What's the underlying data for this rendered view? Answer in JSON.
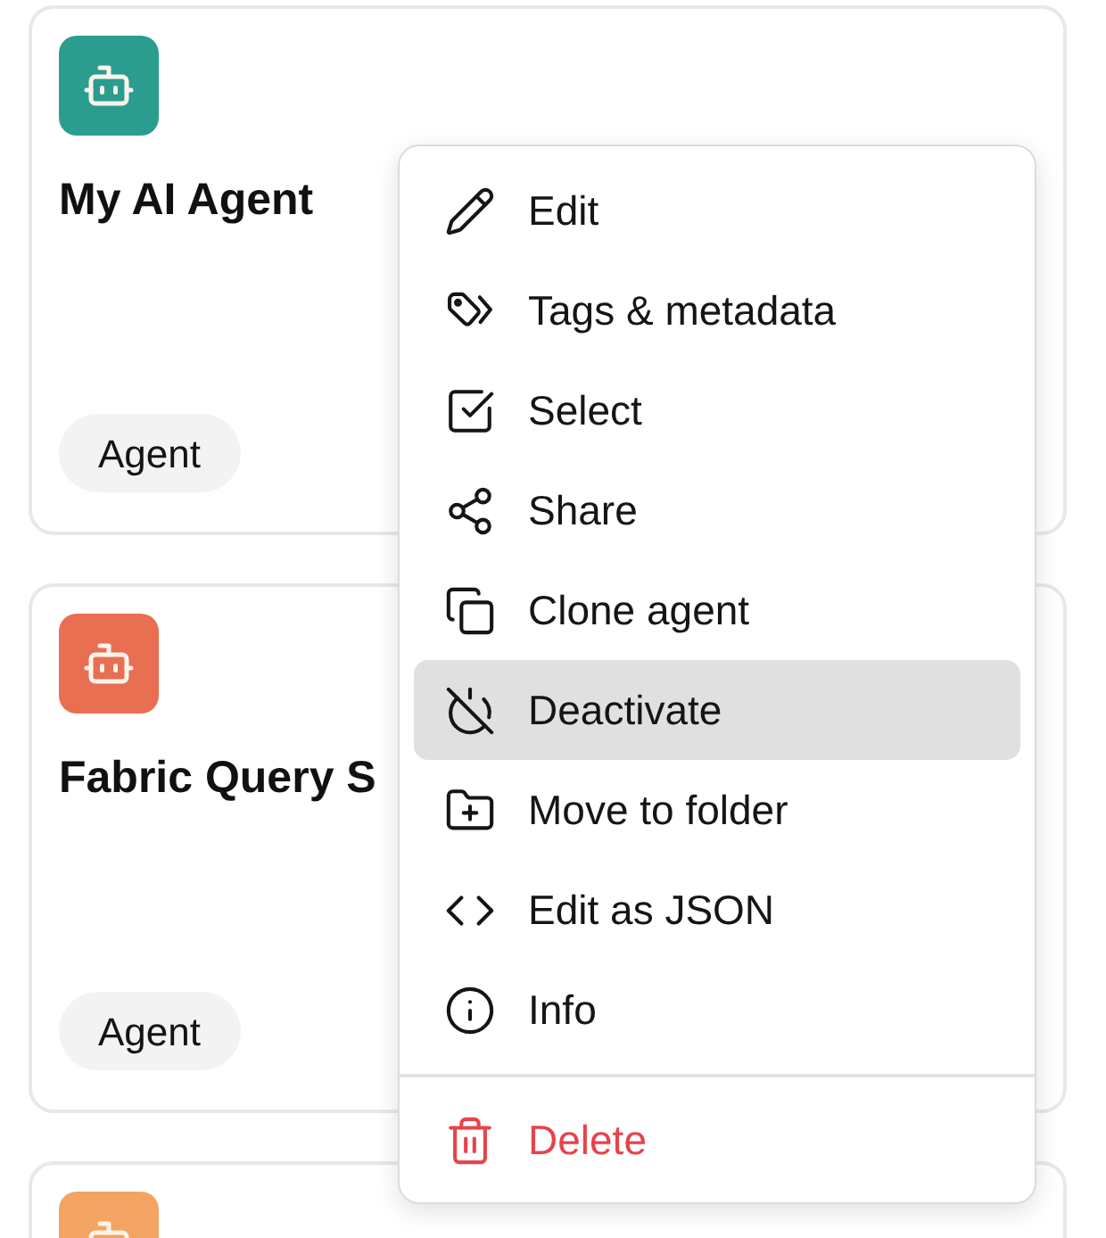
{
  "cards": [
    {
      "color": "#2a9d8f",
      "title": "My AI Agent",
      "badge": "Agent"
    },
    {
      "color": "#e86f51",
      "title": "Fabric Query S",
      "badge": "Agent"
    },
    {
      "color": "#f4a462"
    }
  ],
  "menu": {
    "sections": [
      {
        "items": [
          {
            "label": "Edit",
            "kind": "normal",
            "highlighted": false
          },
          {
            "label": "Tags & metadata",
            "kind": "normal",
            "highlighted": false
          },
          {
            "label": "Select",
            "kind": "normal",
            "highlighted": false
          },
          {
            "label": "Share",
            "kind": "normal",
            "highlighted": false
          },
          {
            "label": "Clone agent",
            "kind": "normal",
            "highlighted": false
          },
          {
            "label": "Deactivate",
            "kind": "normal",
            "highlighted": true
          },
          {
            "label": "Move to folder",
            "kind": "normal",
            "highlighted": false
          },
          {
            "label": "Edit as JSON",
            "kind": "normal",
            "highlighted": false
          },
          {
            "label": "Info",
            "kind": "normal",
            "highlighted": false
          }
        ]
      },
      {
        "items": [
          {
            "label": "Delete",
            "kind": "destructive",
            "highlighted": false
          }
        ]
      }
    ]
  }
}
